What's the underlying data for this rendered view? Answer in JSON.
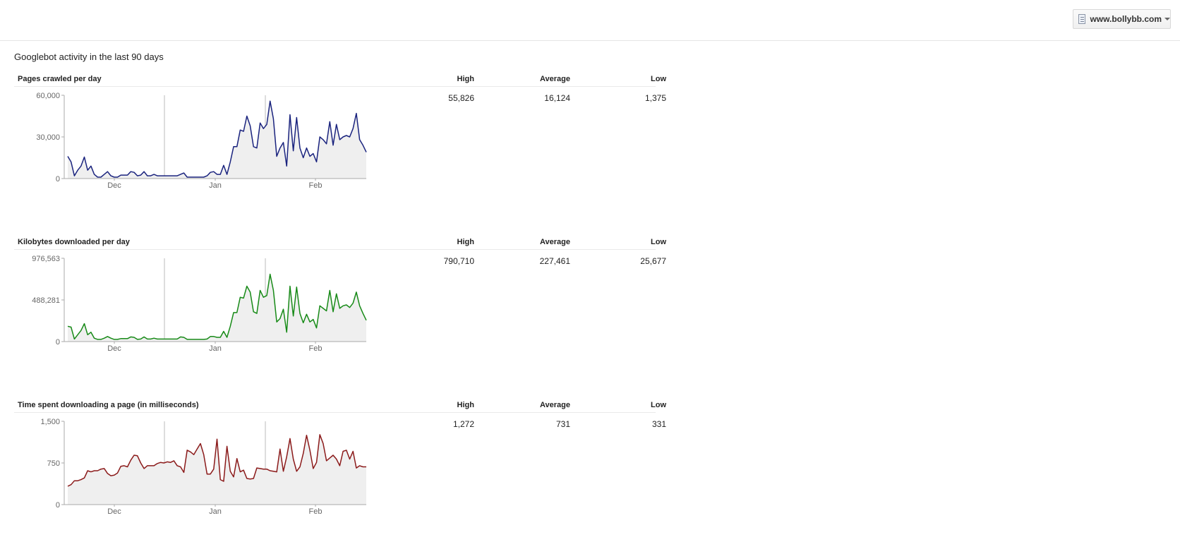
{
  "header": {
    "site": "www.bollybb.com"
  },
  "page_title": "Googlebot activity in the last 90 days",
  "columns": {
    "high": "High",
    "average": "Average",
    "low": "Low"
  },
  "sections": [
    {
      "title": "Pages crawled per day",
      "high": "55,826",
      "average": "16,124",
      "low": "1,375"
    },
    {
      "title": "Kilobytes downloaded per day",
      "high": "790,710",
      "average": "227,461",
      "low": "25,677"
    },
    {
      "title": "Time spent downloading a page (in milliseconds)",
      "high": "1,272",
      "average": "731",
      "low": "331"
    }
  ],
  "chart_data": [
    {
      "type": "area",
      "color": "#1a237e",
      "ylim": [
        0,
        60000
      ],
      "yticks": [
        "60,000",
        "30,000",
        "0"
      ],
      "xticks": [
        "Dec",
        "Jan",
        "Feb"
      ],
      "values": [
        16000,
        12000,
        2000,
        6000,
        9000,
        15500,
        6000,
        9000,
        3000,
        1000,
        1000,
        3000,
        5000,
        2000,
        1000,
        1000,
        2500,
        2500,
        2500,
        5000,
        4500,
        2000,
        2500,
        5000,
        2000,
        2000,
        3000,
        2000,
        2000,
        2000,
        2000,
        2000,
        2000,
        2000,
        3000,
        4000,
        1000,
        1000,
        1000,
        1000,
        1000,
        1000,
        2000,
        4500,
        5000,
        3000,
        3000,
        9500,
        3000,
        12000,
        23000,
        23000,
        35000,
        34000,
        45000,
        38000,
        23000,
        22000,
        40000,
        36000,
        39000,
        55826,
        43000,
        16000,
        22000,
        26000,
        9000,
        46000,
        20000,
        44000,
        22000,
        15000,
        22000,
        16000,
        18000,
        12000,
        30000,
        28000,
        25000,
        41000,
        24000,
        39000,
        28000,
        30000,
        31000,
        30000,
        36000,
        47000,
        28000,
        24000,
        19000
      ]
    },
    {
      "type": "area",
      "color": "#178a17",
      "ylim": [
        0,
        976563
      ],
      "yticks": [
        "976,563",
        "488,281",
        "0"
      ],
      "xticks": [
        "Dec",
        "Jan",
        "Feb"
      ],
      "values": [
        180000,
        170000,
        30000,
        80000,
        130000,
        210000,
        80000,
        110000,
        40000,
        25677,
        25677,
        40000,
        60000,
        40000,
        25677,
        25677,
        35000,
        35000,
        35000,
        55000,
        50000,
        25677,
        30000,
        55000,
        30000,
        30000,
        40000,
        30000,
        30000,
        30000,
        30000,
        30000,
        30000,
        30000,
        55000,
        50000,
        25677,
        25677,
        25677,
        25677,
        25677,
        25677,
        30000,
        60000,
        60000,
        50000,
        50000,
        120000,
        50000,
        180000,
        340000,
        340000,
        520000,
        510000,
        650000,
        580000,
        350000,
        330000,
        600000,
        520000,
        540000,
        790710,
        600000,
        230000,
        270000,
        380000,
        110000,
        650000,
        300000,
        640000,
        330000,
        220000,
        320000,
        230000,
        260000,
        160000,
        420000,
        390000,
        360000,
        600000,
        350000,
        560000,
        390000,
        420000,
        430000,
        400000,
        450000,
        580000,
        420000,
        330000,
        250000
      ]
    },
    {
      "type": "area",
      "color": "#8b1a1a",
      "ylim": [
        0,
        1500
      ],
      "yticks": [
        "1,500",
        "750",
        "0"
      ],
      "xticks": [
        "Dec",
        "Jan",
        "Feb"
      ],
      "values": [
        331,
        360,
        430,
        430,
        450,
        480,
        610,
        590,
        610,
        610,
        640,
        650,
        560,
        520,
        530,
        570,
        690,
        700,
        680,
        800,
        890,
        880,
        750,
        650,
        700,
        700,
        700,
        740,
        760,
        750,
        770,
        760,
        790,
        700,
        680,
        580,
        980,
        950,
        900,
        1000,
        1100,
        900,
        550,
        550,
        640,
        1180,
        450,
        420,
        1050,
        600,
        500,
        830,
        590,
        620,
        470,
        460,
        470,
        660,
        650,
        640,
        640,
        610,
        600,
        590,
        1000,
        600,
        860,
        1190,
        820,
        600,
        680,
        920,
        1250,
        980,
        650,
        760,
        1260,
        1100,
        790,
        840,
        890,
        820,
        700,
        960,
        980,
        820,
        960,
        660,
        700,
        680,
        680
      ]
    }
  ]
}
